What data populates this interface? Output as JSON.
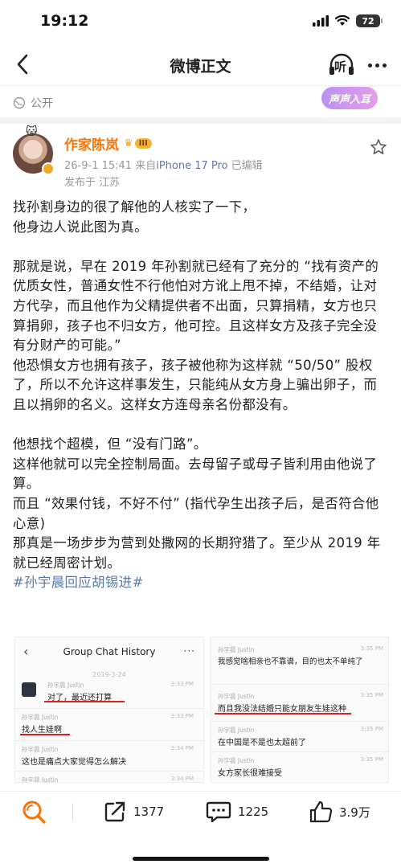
{
  "status_bar": {
    "time": "19:12",
    "battery": "72"
  },
  "nav": {
    "title": "微博正文",
    "listen_label": "听"
  },
  "visibility": {
    "label": "公开",
    "voice_badge": "声声入耳"
  },
  "post": {
    "author": "作家陈岚",
    "vip_level": "III",
    "date": "26-9-1 15:41",
    "source_prefix": "来自",
    "device": "iPhone 17 Pro",
    "edited": "已编辑",
    "location": "发布于 江苏",
    "paragraphs": [
      "找孙割身边的很了解他的人核实了一下，\n他身边人说此图为真。",
      "那就是说，早在 2019 年孙割就已经有了充分的 “找有资产的优质女性，普通女性不行他怕对方讹上甩不掉，不结婚，让对方代孕，而且他作为父精提供者不出面，只算捐精，女方也只算捐卵，孩子也不归女方，他可控。且这样女方及孩子完全没有分财产的可能。”\n他恐惧女方也拥有孩子，孩子被他称为这样就 “50/50” 股权了，所以不允许这样事发生，只能纯从女方身上骗出卵子，而且以捐卵的名义。这样女方连母亲名份都没有。",
      "他想找个超模，但 “没有门路”。\n这样他就可以完全控制局面。去母留子或母子皆利用由他说了算。\n而且 “效果付钱，不好不付” (指代孕生出孩子后，是否符合他心意)\n那真是一场步步为营到处撒网的长期狩猎了。至少从 2019 年就已经周密计划。"
    ],
    "hashtag": "#孙宇晨回应胡锡进#"
  },
  "chat_left": {
    "title": "Group Chat History",
    "date": "2019-3-24",
    "messages": [
      {
        "name": "孙宇晨 Justin",
        "time": "3:33 PM",
        "text": "对了，最近还打算"
      },
      {
        "name": "孙宇晨 Justin",
        "time": "3:33 PM",
        "text": "找人生娃啊"
      },
      {
        "name": "孙宇晨 Justin",
        "time": "3:34 PM",
        "text": "这也是痛点大家觉得怎么解决"
      },
      {
        "name": "孙宇晨 Justin",
        "time": "3:34 PM",
        "text": ""
      }
    ]
  },
  "chat_right": {
    "messages": [
      {
        "name": "孙宇晨 Justin",
        "time": "3:35 PM",
        "text": "我感觉啥相亲也不靠谱，目的也太不单纯了"
      },
      {
        "name": "孙宇晨 Justin",
        "time": "3:35 PM",
        "text": "而且我没法结婚只能女朋友生娃这种"
      },
      {
        "name": "孙宇晨 Justin",
        "time": "3:35 PM",
        "text": "在中国是不是也太超前了"
      },
      {
        "name": "孙宇晨 Justin",
        "time": "3:35 PM",
        "text": "女方家长很难接受"
      }
    ]
  },
  "actions": {
    "share_count": "1377",
    "comment_count": "1225",
    "like_count": "3.9万"
  },
  "colors": {
    "accent_orange": "#f5750b",
    "link_blue": "#5b79a8",
    "underline_red": "#d8231f"
  }
}
